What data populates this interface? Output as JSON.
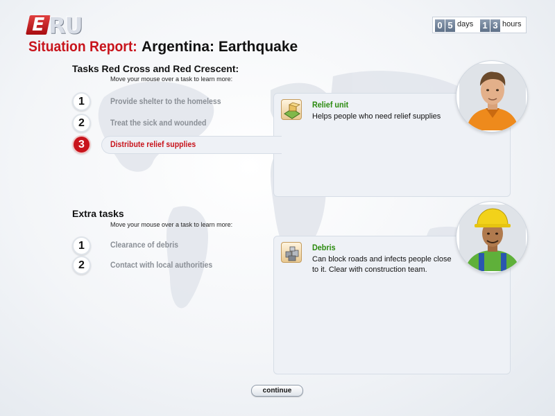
{
  "logo": {
    "e": "E",
    "ru": "RU"
  },
  "header": {
    "title_label": "Situation Report:",
    "title_value": "Argentina: Earthquake"
  },
  "timer": {
    "days_digits": [
      "0",
      "5"
    ],
    "days_label": "days",
    "hours_digits": [
      "1",
      "3"
    ],
    "hours_label": "hours"
  },
  "tasks": {
    "heading": "Tasks Red Cross and Red Crescent:",
    "hint": "Move your mouse over a task to learn more:",
    "items": [
      {
        "num": "1",
        "label": "Provide shelter to the homeless"
      },
      {
        "num": "2",
        "label": "Treat the sick and wounded"
      },
      {
        "num": "3",
        "label": "Distribute relief supplies"
      }
    ],
    "active_index": 2,
    "info": {
      "icon": "relief-unit-icon",
      "title": "Relief unit",
      "description": "Helps people who need relief supplies"
    },
    "portrait": "relief-worker-portrait"
  },
  "extra": {
    "heading": "Extra tasks",
    "hint": "Move your mouse over a task to learn more:",
    "items": [
      {
        "num": "1",
        "label": "Clearance of debris"
      },
      {
        "num": "2",
        "label": "Contact with local authorities"
      }
    ],
    "info": {
      "icon": "debris-icon",
      "title": "Debris",
      "description_line1": "Can block roads and infects people close",
      "description_line2": "to it. Clear with construction team."
    },
    "portrait": "construction-worker-portrait"
  },
  "continue_label": "continue",
  "colors": {
    "accent_red": "#c8141c",
    "info_green": "#2a8a0e",
    "task_grey": "#8a8f96",
    "panel_bg": "#eef1f6"
  }
}
